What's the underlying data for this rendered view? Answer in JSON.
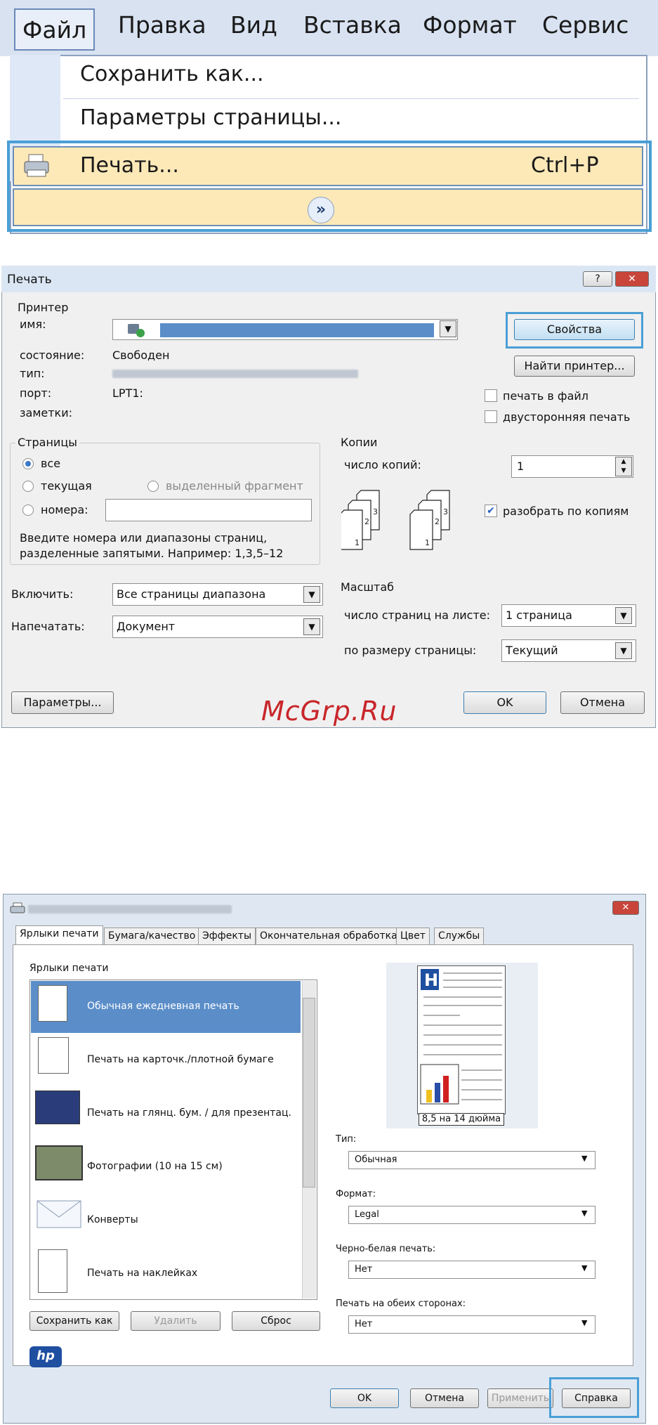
{
  "menu": {
    "items": [
      "Файл",
      "Правка",
      "Вид",
      "Вставка",
      "Формат",
      "Сервис"
    ],
    "dropdown": {
      "save_as": "Сохранить как...",
      "page_setup": "Параметры страницы...",
      "print": "Печать...",
      "print_shortcut": "Ctrl+P",
      "expand_icon": "double-chevron-down-icon"
    }
  },
  "print_dialog": {
    "title": "Печать",
    "help_button": "?",
    "close_button": "✕",
    "printer": {
      "group_label": "Принтер",
      "name_label": "имя:",
      "status_label": "состояние:",
      "status_value": "Свободен",
      "type_label": "тип:",
      "port_label": "порт:",
      "port_value": "LPT1:",
      "notes_label": "заметки:",
      "properties_button": "Свойства",
      "find_printer_button": "Найти принтер...",
      "print_to_file": "печать в файл",
      "duplex": "двусторонняя печать"
    },
    "pages": {
      "group_label": "Страницы",
      "all": "все",
      "current": "текущая",
      "selection": "выделенный фрагмент",
      "pages": "номера:",
      "hint_line1": "Введите номера или диапазоны страниц,",
      "hint_line2": "разделенные запятыми. Например: 1,3,5–12"
    },
    "copies": {
      "group_label": "Копии",
      "count_label": "число копий:",
      "count_value": "1",
      "collate": "разобрать по копиям",
      "collate_checked": true
    },
    "include_label": "Включить:",
    "include_value": "Все страницы диапазона",
    "print_what_label": "Напечатать:",
    "print_what_value": "Документ",
    "zoom": {
      "group_label": "Масштаб",
      "pages_per_sheet_label": "число страниц на листе:",
      "pages_per_sheet_value": "1 страница",
      "scale_label": "по размеру страницы:",
      "scale_value": "Текущий"
    },
    "options_button": "Параметры...",
    "ok_button": "OK",
    "cancel_button": "Отмена"
  },
  "watermark": "McGrp.Ru",
  "props_dialog": {
    "close_button": "✕",
    "tabs": [
      "Ярлыки печати",
      "Бумага/качество",
      "Эффекты",
      "Окончательная обработка",
      "Цвет",
      "Службы"
    ],
    "list_label": "Ярлыки печати",
    "shortcuts": [
      "Обычная ежедневная печать",
      "Печать на карточк./плотной бумаге",
      "Печать на глянц. бум. / для презентац.",
      "Фотографии (10 на 15 см)",
      "Конверты",
      "Печать на наклейках"
    ],
    "preview_size": "8,5 на 14 дюйма",
    "type_label": "Тип:",
    "type_value": "Обычная",
    "format_label": "Формат:",
    "format_value": "Legal",
    "bw_label": "Черно-белая печать:",
    "bw_value": "Нет",
    "duplex_label": "Печать на обеих сторонах:",
    "duplex_value": "Нет",
    "save_as_button": "Сохранить как",
    "delete_button": "Удалить",
    "reset_button": "Сброс",
    "ok_button": "OK",
    "cancel_button": "Отмена",
    "apply_button": "Применить",
    "help_button": "Справка",
    "logo": "hp"
  },
  "colors": {
    "highlight": "#4a9fd6",
    "menu_hover": "#fde9b8",
    "selection": "#5b8ec9"
  }
}
